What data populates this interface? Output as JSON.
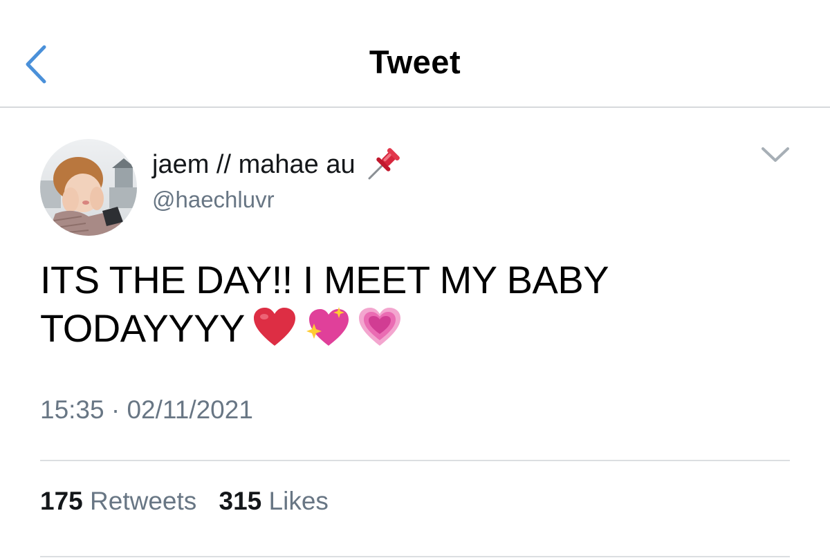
{
  "nav": {
    "title": "Tweet",
    "back_icon": "chevron-left-icon",
    "accent_color": "#4a90d9"
  },
  "tweet": {
    "display_name": "jaem // mahae au",
    "name_emoji": "pushpin-icon",
    "handle": "@haechluvr",
    "text_line1": "ITS THE DAY!! I MEET MY BABY",
    "text_line2": "TODAYYYY",
    "emojis": [
      "red-heart-icon",
      "sparkling-heart-icon",
      "growing-heart-icon"
    ],
    "timestamp": "15:35 · 02/11/2021",
    "options_icon": "chevron-down-icon"
  },
  "stats": {
    "retweets_count": "175",
    "retweets_label": "Retweets",
    "likes_count": "315",
    "likes_label": "Likes"
  }
}
